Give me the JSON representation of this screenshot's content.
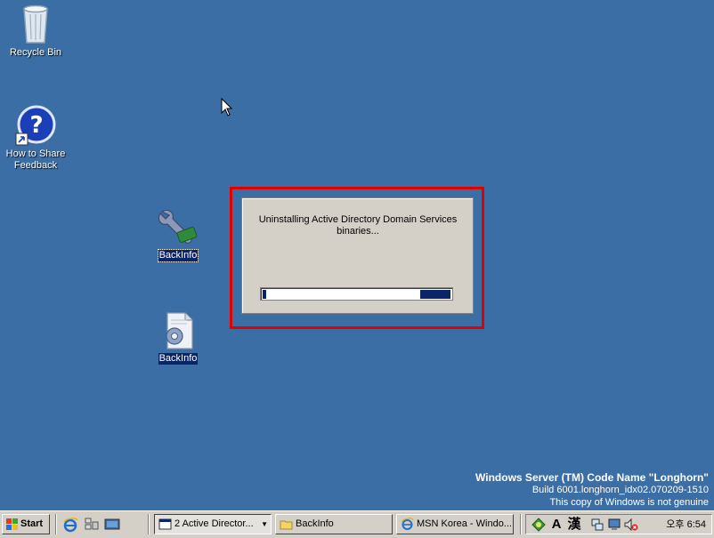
{
  "desktop": {
    "icons": [
      {
        "label": "Recycle Bin"
      },
      {
        "label": "How to Share Feedback"
      },
      {
        "label": "BackInfo"
      },
      {
        "label": "BackInfo"
      }
    ]
  },
  "dialog": {
    "message": "Uninstalling Active Directory Domain Services binaries...",
    "progress_segments": [
      0.02,
      0.16
    ]
  },
  "watermark": {
    "line1": "Windows Server (TM) Code Name \"Longhorn\"",
    "line2": "Build 6001.longhorn_idx02.070209-1510",
    "line3": "This copy of Windows is not genuine"
  },
  "taskbar": {
    "start_label": "Start",
    "tasks": [
      {
        "label": "2 Active Director..."
      },
      {
        "label": "BackInfo"
      },
      {
        "label": "MSN Korea - Windo..."
      }
    ],
    "tray": {
      "ime_a": "A",
      "ime_han": "漢",
      "clock": "오후 6:54"
    }
  },
  "colors": {
    "desktop": "#3a6ea5",
    "highlight": "#e00000",
    "progress": "#0a246a"
  }
}
